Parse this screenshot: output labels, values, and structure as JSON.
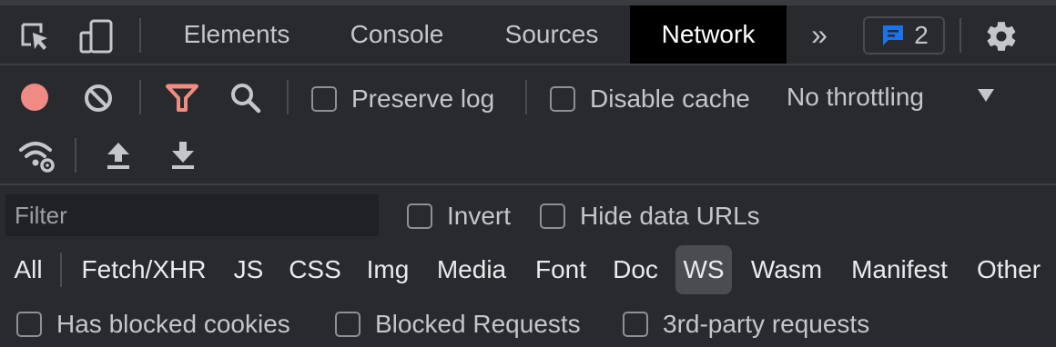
{
  "tabs": {
    "elements": "Elements",
    "console": "Console",
    "sources": "Sources",
    "network": "Network",
    "more": "»"
  },
  "issues_count": "2",
  "toolbar": {
    "preserve_log": "Preserve log",
    "disable_cache": "Disable cache",
    "throttling": "No throttling"
  },
  "filter": {
    "placeholder": "Filter",
    "invert": "Invert",
    "hide_data_urls": "Hide data URLs"
  },
  "types": {
    "all": "All",
    "fetch": "Fetch/XHR",
    "js": "JS",
    "css": "CSS",
    "img": "Img",
    "media": "Media",
    "font": "Font",
    "doc": "Doc",
    "ws": "WS",
    "wasm": "Wasm",
    "manifest": "Manifest",
    "other": "Other"
  },
  "bottom": {
    "blocked_cookies": "Has blocked cookies",
    "blocked_requests": "Blocked Requests",
    "third_party": "3rd-party requests"
  },
  "colors": {
    "record": "#ef8a84",
    "filter_active": "#f28b82",
    "issues_icon": "#1a73e8",
    "active_tab_bg": "#000000",
    "active_type_bg": "#4a4c50"
  },
  "icons": [
    "inspect-element-icon",
    "device-toolbar-icon",
    "message-icon",
    "gear-icon",
    "record-icon",
    "clear-icon",
    "filter-icon",
    "search-icon",
    "network-conditions-icon",
    "upload-icon",
    "download-icon"
  ]
}
